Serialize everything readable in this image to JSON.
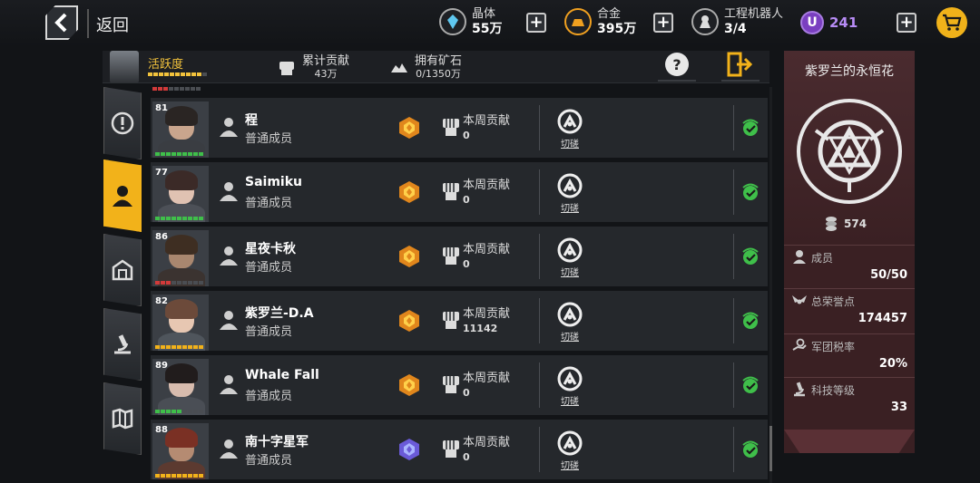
{
  "header": {
    "back_label": "返回",
    "resources": [
      {
        "label": "晶体",
        "value": "55万",
        "icon": "crystal-icon"
      },
      {
        "label": "合金",
        "value": "395万",
        "icon": "alloy-icon"
      },
      {
        "label": "工程机器人",
        "value": "3/4",
        "icon": "robot-icon"
      }
    ],
    "premium": {
      "badge": "U",
      "value": "241"
    }
  },
  "infobar": {
    "activity_label": "活跃度",
    "total_contribution_label": "累计贡献",
    "total_contribution_value": "43万",
    "ore_label": "拥有矿石",
    "ore_value": "0/1350万",
    "help_label": "?"
  },
  "members": [
    {
      "level": "81",
      "name": "程",
      "role": "普通成员",
      "week_label": "本周贡献",
      "week_value": "0",
      "duel_label": "切磋",
      "rank": "gold"
    },
    {
      "level": "77",
      "name": "Saimiku",
      "role": "普通成员",
      "week_label": "本周贡献",
      "week_value": "0",
      "duel_label": "切磋",
      "rank": "gold"
    },
    {
      "level": "86",
      "name": "星夜卡秋",
      "role": "普通成员",
      "week_label": "本周贡献",
      "week_value": "0",
      "duel_label": "切磋",
      "rank": "gold"
    },
    {
      "level": "82",
      "name": "紫罗兰-D.A",
      "role": "普通成员",
      "week_label": "本周贡献",
      "week_value": "11142",
      "duel_label": "切磋",
      "rank": "gold"
    },
    {
      "level": "89",
      "name": "Whale  Fall",
      "role": "普通成员",
      "week_label": "本周贡献",
      "week_value": "0",
      "duel_label": "切磋",
      "rank": "gold"
    },
    {
      "level": "88",
      "name": "南十字星军",
      "role": "普通成员",
      "week_label": "本周贡献",
      "week_value": "0",
      "duel_label": "切磋",
      "rank": "purple"
    }
  ],
  "legion": {
    "name": "紫罗兰的永恒花",
    "score": "574",
    "stats": [
      {
        "label": "成员",
        "value": "50/50",
        "icon": "member-icon"
      },
      {
        "label": "总荣誉点",
        "value": "174457",
        "icon": "honor-wings-icon"
      },
      {
        "label": "军团税率",
        "value": "20%",
        "icon": "tax-icon"
      },
      {
        "label": "科技等级",
        "value": "33",
        "icon": "microscope-icon"
      }
    ]
  },
  "colors": {
    "accent": "#f2b21a",
    "online": "#3fbf4a",
    "panel": "#3a2023",
    "premium": "#7a3fc0"
  }
}
